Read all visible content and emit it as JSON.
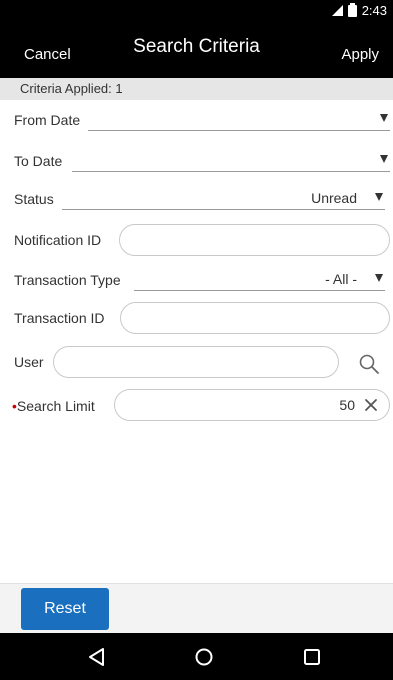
{
  "status_bar": {
    "time": "2:43"
  },
  "header": {
    "cancel_label": "Cancel",
    "title": "Search Criteria",
    "apply_label": "Apply"
  },
  "criteria_applied": "Criteria Applied: 1",
  "fields": {
    "from_date": {
      "label": "From Date",
      "value": ""
    },
    "to_date": {
      "label": "To Date",
      "value": ""
    },
    "status": {
      "label": "Status",
      "value": "Unread"
    },
    "notification_id": {
      "label": "Notification ID",
      "value": ""
    },
    "transaction_type": {
      "label": "Transaction Type",
      "value": "- All -"
    },
    "transaction_id": {
      "label": "Transaction ID",
      "value": ""
    },
    "user": {
      "label": "User",
      "value": ""
    },
    "search_limit": {
      "required_marker": "•",
      "label": "Search Limit",
      "value": "50"
    }
  },
  "footer": {
    "reset_label": "Reset"
  },
  "icons": {
    "dropdown": "triangle-down-icon",
    "search": "search-icon",
    "clear": "close-icon",
    "nav": [
      "back-icon",
      "home-icon",
      "recents-icon"
    ]
  },
  "colors": {
    "header_bg": "#000000",
    "reset_bg": "#1a6fbe",
    "applied_bg": "#e6e6e6",
    "required": "#cc0000"
  }
}
